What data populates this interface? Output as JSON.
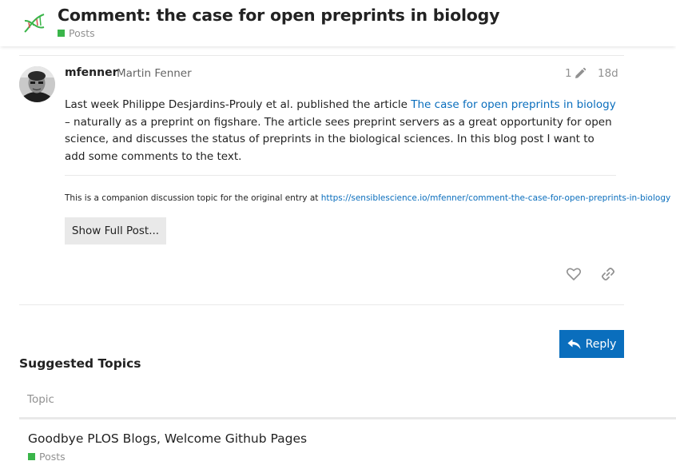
{
  "colors": {
    "category": "#3ab54a",
    "link": "#0a6ebd",
    "primary_button": "#0a6ebd",
    "muted": "#919191"
  },
  "header": {
    "logo_icon": "dna-helix-icon",
    "title": "Comment: the case for open preprints in biology",
    "category": "Posts"
  },
  "post": {
    "username": "mfenner",
    "full_name": "Martin Fenner",
    "edit_count": "1",
    "edit_icon": "pencil-icon",
    "age": "18d",
    "body": {
      "before_link": "Last week Philippe Desjardins-Prouly et al. published the article ",
      "link_text": "The case for open preprints in biology",
      "after_link": " – naturally as a preprint on figshare. The article sees preprint servers as a great opportunity for open science, and discusses the status of preprints in the biological sciences. In this blog post I want to add some comments to the text."
    },
    "companion_text": "This is a companion discussion topic for the original entry at ",
    "companion_url": "https://sensiblescience.io/mfenner/comment-the-case-for-open-preprints-in-biology",
    "show_full_label": "Show Full Post...",
    "like_icon": "heart-icon",
    "share_icon": "link-icon"
  },
  "reply": {
    "label": "Reply",
    "icon": "reply-arrow-icon"
  },
  "suggested": {
    "heading": "Suggested Topics",
    "column_topic": "Topic",
    "topics": [
      {
        "title": "Goodbye PLOS Blogs, Welcome Github Pages",
        "category": "Posts"
      }
    ]
  }
}
